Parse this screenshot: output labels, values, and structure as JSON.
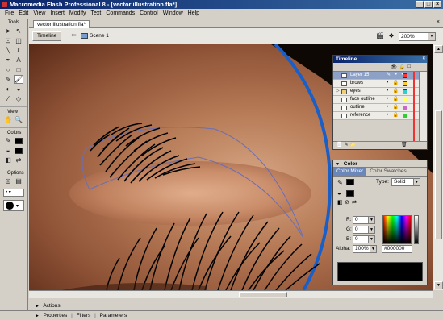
{
  "window": {
    "title": "Macromedia Flash Professional 8 - [vector illustration.fla*]"
  },
  "menu": [
    "File",
    "Edit",
    "View",
    "Insert",
    "Modify",
    "Text",
    "Commands",
    "Control",
    "Window",
    "Help"
  ],
  "tools": {
    "title": "Tools",
    "view_label": "View",
    "colors_label": "Colors",
    "options_label": "Options",
    "stroke_color": "#000000",
    "fill_color": "#000000"
  },
  "document": {
    "tab_label": "vector illustration.fla*",
    "close_glyph": "×",
    "timeline_button": "Timeline",
    "scene_label": "Scene 1",
    "zoom": "200%"
  },
  "timeline_panel": {
    "title": "Timeline",
    "layers": [
      {
        "name": "Layer 15",
        "color": "#ff3333",
        "selected": true,
        "folder": false
      },
      {
        "name": "brows",
        "color": "#ffcc33",
        "selected": false,
        "folder": false
      },
      {
        "name": "eyes",
        "color": "#33cccc",
        "selected": false,
        "folder": true
      },
      {
        "name": "face outline",
        "color": "#ffff66",
        "selected": false,
        "folder": false
      },
      {
        "name": "outline",
        "color": "#cc66cc",
        "selected": false,
        "folder": false
      },
      {
        "name": "reference",
        "color": "#33cc33",
        "selected": false,
        "folder": false
      }
    ]
  },
  "color_panel": {
    "title": "Color",
    "tab_mixer": "Color Mixer",
    "tab_swatches": "Color Swatches",
    "type_label": "Type:",
    "type_value": "Solid",
    "r_label": "R:",
    "r_value": "0",
    "g_label": "G:",
    "g_value": "0",
    "b_label": "B:",
    "b_value": "0",
    "alpha_label": "Alpha:",
    "alpha_value": "100%",
    "hex_value": "#000000"
  },
  "bottom": {
    "actions": "Actions",
    "properties": "Properties",
    "filters": "Filters",
    "parameters": "Parameters",
    "separator": "|"
  }
}
